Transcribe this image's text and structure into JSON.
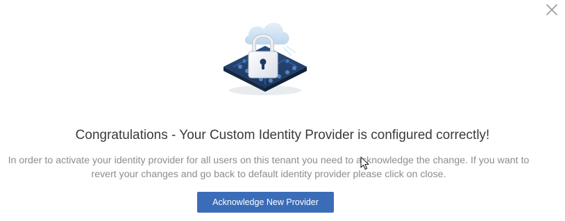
{
  "dialog": {
    "title": "Congratulations - Your Custom Identity Provider is configured correctly!",
    "message": "In order to activate your identity provider for all users on this tenant you need to acknowledge the change. If you want to revert your changes and go back to default identity provider please click on close.",
    "acknowledge_label": "Acknowledge New Provider",
    "close_icon": "close-icon",
    "illustration_icon": "cloud-padlock-chip-icon"
  },
  "colors": {
    "button_bg": "#3b6cb8",
    "button_text": "#ffffff",
    "title_text": "#3a3a3a",
    "message_text": "#8c8c8c",
    "close_icon": "#9a9a9a",
    "chip_base": "#1f3a63",
    "cloud": "#cfe3f3"
  }
}
